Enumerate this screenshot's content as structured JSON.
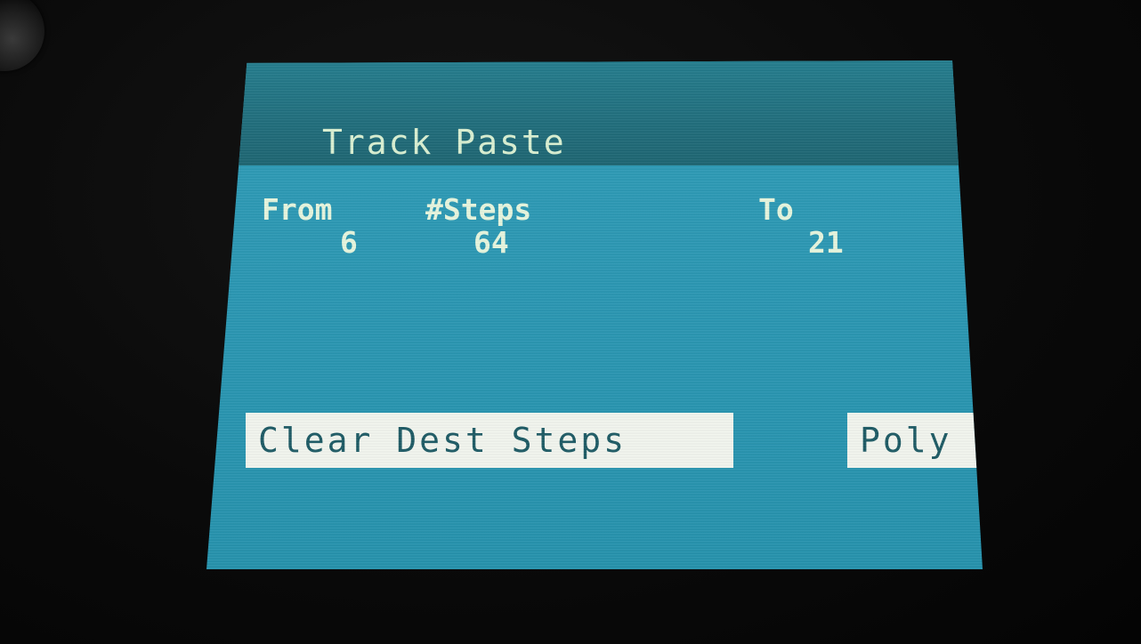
{
  "screen": {
    "title": "Track Paste"
  },
  "params": [
    {
      "label": "From",
      "value": "6"
    },
    {
      "label": "#Steps",
      "value": "64"
    },
    {
      "label": "To",
      "value": "21"
    }
  ],
  "options": {
    "clear_dest": "Clear Dest Steps",
    "mode": "Poly"
  },
  "colors": {
    "lcd_background": "#2a97b3",
    "header_background": "#1f6b79",
    "text": "#e6f6de",
    "option_box": "#f2f5ee",
    "option_text": "#1c5a64"
  }
}
